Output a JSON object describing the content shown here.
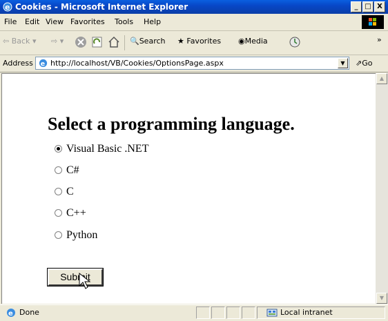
{
  "window": {
    "title": "Cookies - Microsoft Internet Explorer"
  },
  "window_buttons": {
    "minimize": "_",
    "maximize": "□",
    "close": "X"
  },
  "menu": [
    "File",
    "Edit",
    "View",
    "Favorites",
    "Tools",
    "Help"
  ],
  "toolbar": {
    "back_label": "Back",
    "search_label": "Search",
    "favorites_label": "Favorites",
    "media_label": "Media",
    "more_label": "»"
  },
  "address": {
    "label": "Address",
    "url": "http://localhost/VB/Cookies/OptionsPage.aspx",
    "go_label": "Go"
  },
  "page": {
    "heading": "Select a programming language.",
    "options": [
      {
        "label": "Visual Basic .NET",
        "checked": true
      },
      {
        "label": "C#",
        "checked": false
      },
      {
        "label": "C",
        "checked": false
      },
      {
        "label": "C++",
        "checked": false
      },
      {
        "label": "Python",
        "checked": false
      }
    ],
    "submit_label": "Submit"
  },
  "status": {
    "text": "Done",
    "zone": "Local intranet"
  }
}
